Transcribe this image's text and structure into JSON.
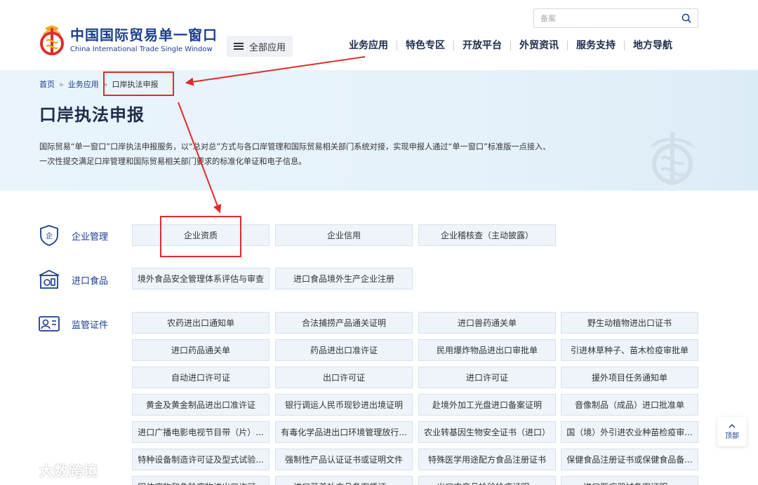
{
  "header": {
    "logo_cn": "中国国际贸易单一窗口",
    "logo_en": "China International Trade Single Window",
    "all_apps_label": "全部应用",
    "search_placeholder": "备案",
    "nav": [
      "业务应用",
      "特色专区",
      "开放平台",
      "外贸资讯",
      "服务支持",
      "地方导航"
    ]
  },
  "breadcrumb": {
    "home": "首页",
    "sep": "»",
    "level1": "业务应用",
    "current": "口岸执法申报"
  },
  "banner": {
    "title": "口岸执法申报",
    "desc_line1": "国际贸易“单一窗口”口岸执法申报服务，以“总对总”方式与各口岸管理和国际贸易相关部门系统对接，实现申报人通过“单一窗口”标准版一点接入、",
    "desc_line2": "一次性提交满足口岸管理和国际贸易相关部门要求的标准化单证和电子信息。"
  },
  "categories": [
    {
      "label": "企业管理",
      "icon": "enterprise-shield-icon",
      "items": [
        "企业资质",
        "企业信用",
        "企业稽核查（主动披露）"
      ]
    },
    {
      "label": "进口食品",
      "icon": "imported-food-icon",
      "items": [
        "境外食品安全管理体系评估与审查",
        "进口食品境外生产企业注册"
      ]
    },
    {
      "label": "监管证件",
      "icon": "certificate-card-icon",
      "items": [
        "农药进出口通知单",
        "合法捕捞产品通关证明",
        "进口兽药通关单",
        "野生动植物进出口证书",
        "进口药品通关单",
        "药品进出口准许证",
        "民用爆炸物品进出口审批单",
        "引进林草种子、苗木检疫审批单",
        "自动进口许可证",
        "出口许可证",
        "进口许可证",
        "援外项目任务通知单",
        "黄金及黄金制品进出口准许证",
        "银行调运人民币现钞进出境证明",
        "赴境外加工光盘进口备案证明",
        "音像制品（成品）进口批准单",
        "进口广播电影电视节目带（片）...",
        "有毒化学品进出口环境管理放行...",
        "农业转基因生物安全证书（进口）",
        "国（境）外引进农业种苗检疫审...",
        "特种设备制造许可证及型式试验...",
        "强制性产品认证证书或证明文件",
        "特殊医学用途配方食品注册证书",
        "保健食品注册证书或保健食品备...",
        "固体废物和危险废物进出口许可...",
        "进口营养补充品备案凭证...",
        "出口农产品检验检疫证明...",
        "进口医疗器械备案证明..."
      ]
    }
  ],
  "to_top_label": "顶部",
  "watermark_text": "大数跨境",
  "colors": {
    "brand": "#1a3e8f",
    "tile_bg": "#eef4f9",
    "annotation": "#e02b2b",
    "banner_bg": "#e7f3fa"
  }
}
